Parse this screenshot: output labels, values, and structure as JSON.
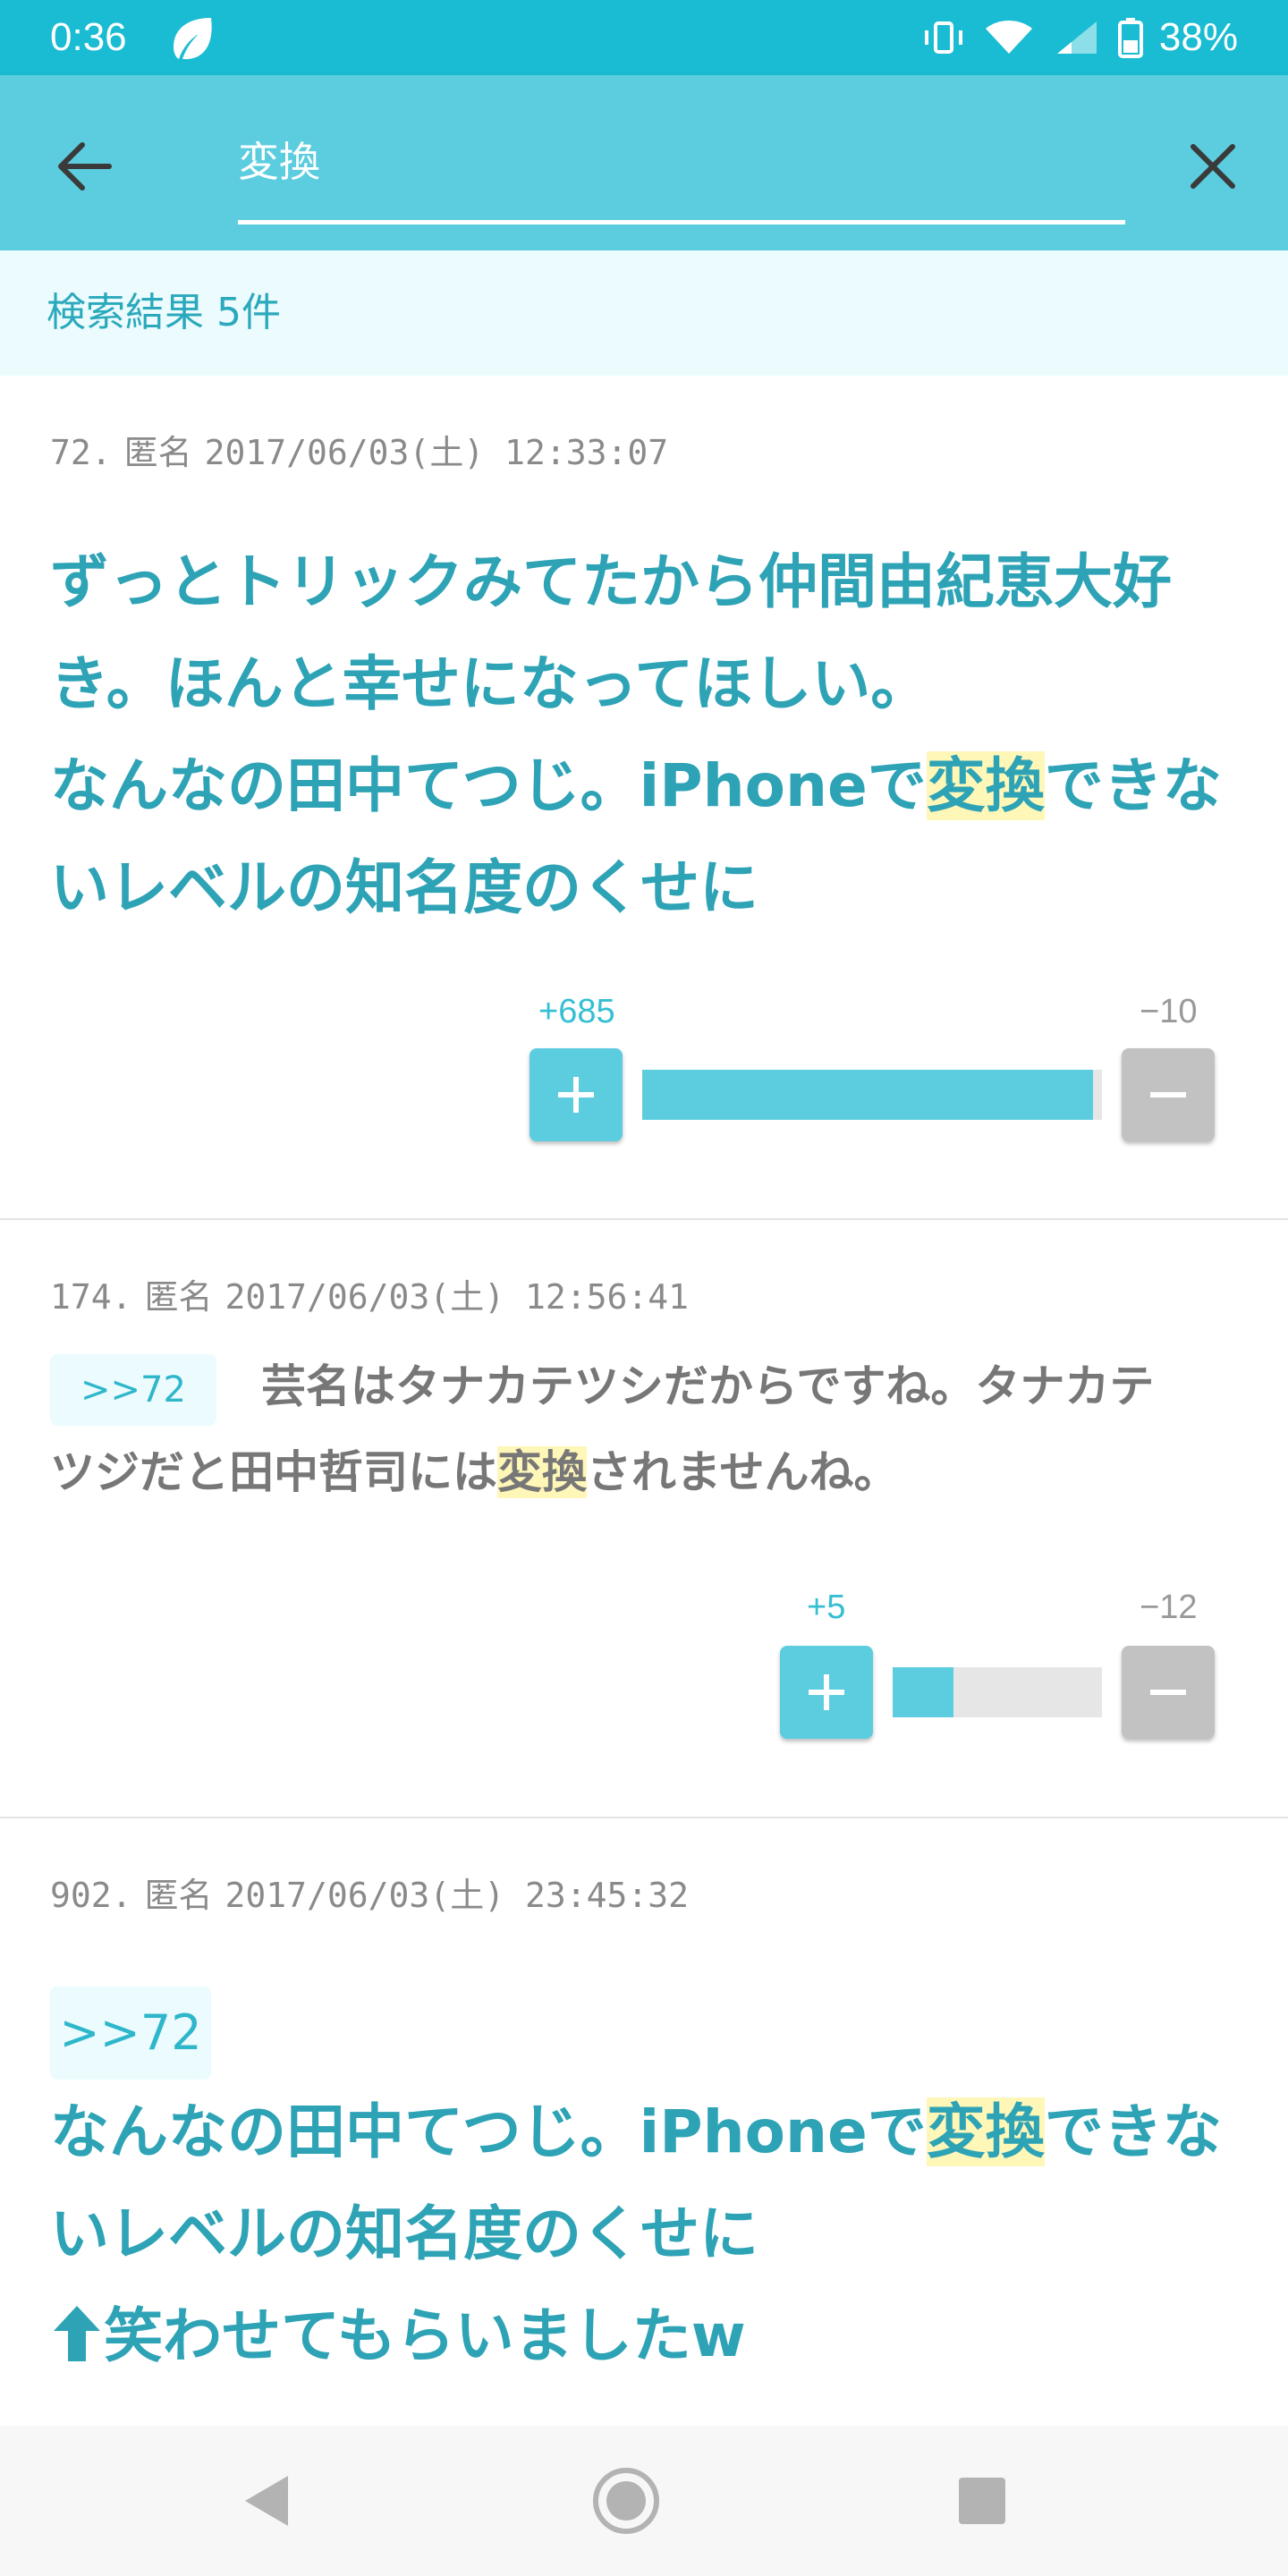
{
  "status_bar": {
    "time": "0:36",
    "battery": "38%"
  },
  "header": {
    "search_value": "変換"
  },
  "results": {
    "count_label": "検索結果 5件"
  },
  "posts": [
    {
      "number": "72.",
      "author": "匿名",
      "datetime": "2017/06/03(土) 12:33:07",
      "line1": "ずっとトリックみてたから仲間由紀恵大好",
      "line2": "き。ほんと幸せになってほしい。",
      "line3_pre": "なんなの田中てつじ。iPhoneで",
      "line3_hl": "変換",
      "line3_post": "できな",
      "line4": "いレベルの知名度のくせに",
      "plus": "+685",
      "minus": "−10",
      "plus_ratio": 0.98
    },
    {
      "number": "174.",
      "author": "匿名",
      "datetime": "2017/06/03(土) 12:56:41",
      "reply": ">>72",
      "line1": "芸名はタナカテツシだからですね。タナカテ",
      "line2_pre": "ツジだと田中哲司には",
      "line2_hl": "変換",
      "line2_post": "されませんね。",
      "plus": "+5",
      "minus": "−12",
      "plus_ratio": 0.29
    },
    {
      "number": "902.",
      "author": "匿名",
      "datetime": "2017/06/03(土) 23:45:32",
      "reply": ">>72",
      "line1_pre": "なんなの田中てつじ。iPhoneで",
      "line1_hl": "変換",
      "line1_post": "できな",
      "line2": "いレベルの知名度のくせに",
      "line3": "笑わせてもらいましたw"
    }
  ]
}
